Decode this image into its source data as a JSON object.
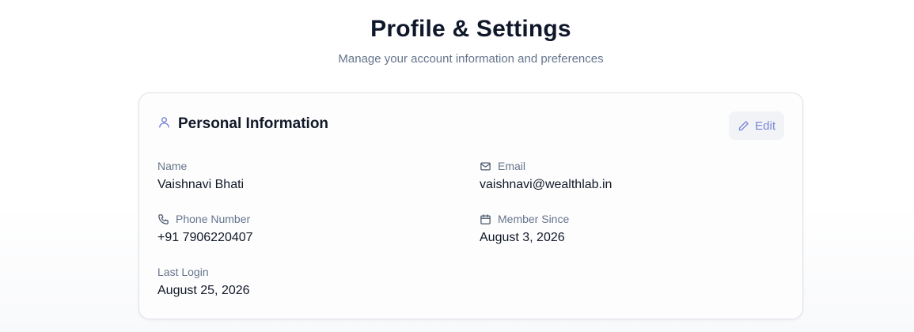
{
  "header": {
    "title": "Profile & Settings",
    "subtitle": "Manage your account information and preferences"
  },
  "card": {
    "title": "Personal Information",
    "title_icon": "user-icon",
    "edit_label": "Edit",
    "edit_icon": "pencil-icon",
    "fields": {
      "name": {
        "label": "Name",
        "value": "Vaishnavi Bhati"
      },
      "email": {
        "label": "Email",
        "value": "vaishnavi@wealthlab.in",
        "icon": "mail-icon"
      },
      "phone": {
        "label": "Phone Number",
        "value": "+91 7906220407",
        "icon": "phone-icon"
      },
      "member_since": {
        "label": "Member Since",
        "value": "August 3, 2026",
        "icon": "calendar-icon"
      },
      "last_login": {
        "label": "Last Login",
        "value": "August 25, 2026"
      }
    }
  },
  "colors": {
    "accent": "#7b86d6",
    "title": "#0f172a",
    "muted": "#64748b",
    "card_border": "#dfe3e8"
  }
}
